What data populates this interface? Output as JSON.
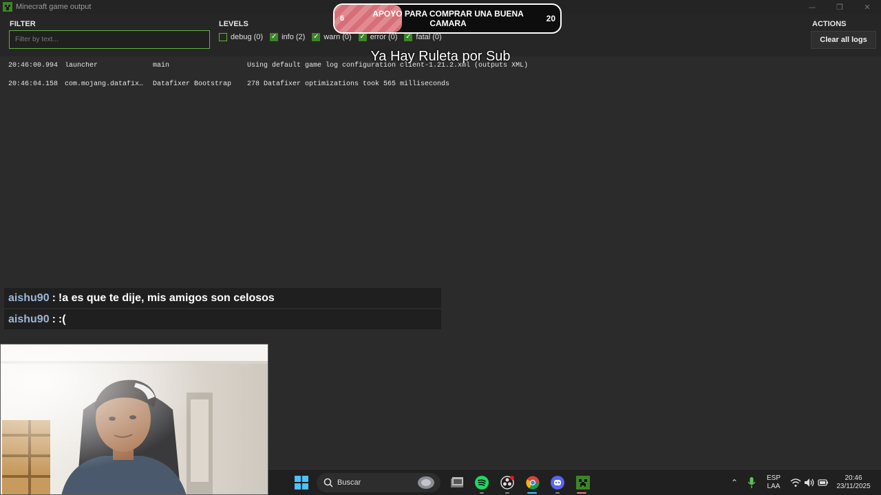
{
  "window": {
    "title": "Minecraft game output",
    "minimize_glyph": "—",
    "restore_glyph": "❐",
    "close_glyph": "✕"
  },
  "toolbar": {
    "filter_label": "FILTER",
    "filter_placeholder": "Filter by text...",
    "filter_value": "",
    "levels_label": "LEVELS",
    "levels": [
      {
        "label": "debug (0)",
        "checked": false
      },
      {
        "label": "info (2)",
        "checked": true
      },
      {
        "label": "warn (0)",
        "checked": true
      },
      {
        "label": "error (0)",
        "checked": true
      },
      {
        "label": "fatal (0)",
        "checked": true
      }
    ],
    "actions_label": "ACTIONS",
    "clear_label": "Clear all logs"
  },
  "logs": [
    {
      "time": "20:46:00.994",
      "logger": "launcher",
      "thread": "main",
      "message": "Using default game log configuration client-1.21.2.xml (outputs XML)"
    },
    {
      "time": "20:46:04.158",
      "logger": "com.mojang.datafixer…",
      "thread": "Datafixer Bootstrap",
      "message": "278 Datafixer optimizations took 565 milliseconds"
    }
  ],
  "overlay": {
    "goal": {
      "start": "6",
      "end": "20",
      "current_fraction": 0.3,
      "text": "APOYO PARA COMPRAR UNA BUENA CAMARA"
    },
    "banner": "Ya Hay Ruleta por Sub",
    "chat": [
      {
        "user": "aishu90",
        "sep": ":",
        "text": "!a es que te dije, mis amigos son celosos"
      },
      {
        "user": "aishu90",
        "sep": ":",
        "text": ":("
      }
    ]
  },
  "taskbar": {
    "search_label": "Buscar",
    "lang_top": "ESP",
    "lang_bottom": "LAA",
    "time": "20:46",
    "date": "23/11/2025",
    "accent": "#3c8527"
  }
}
